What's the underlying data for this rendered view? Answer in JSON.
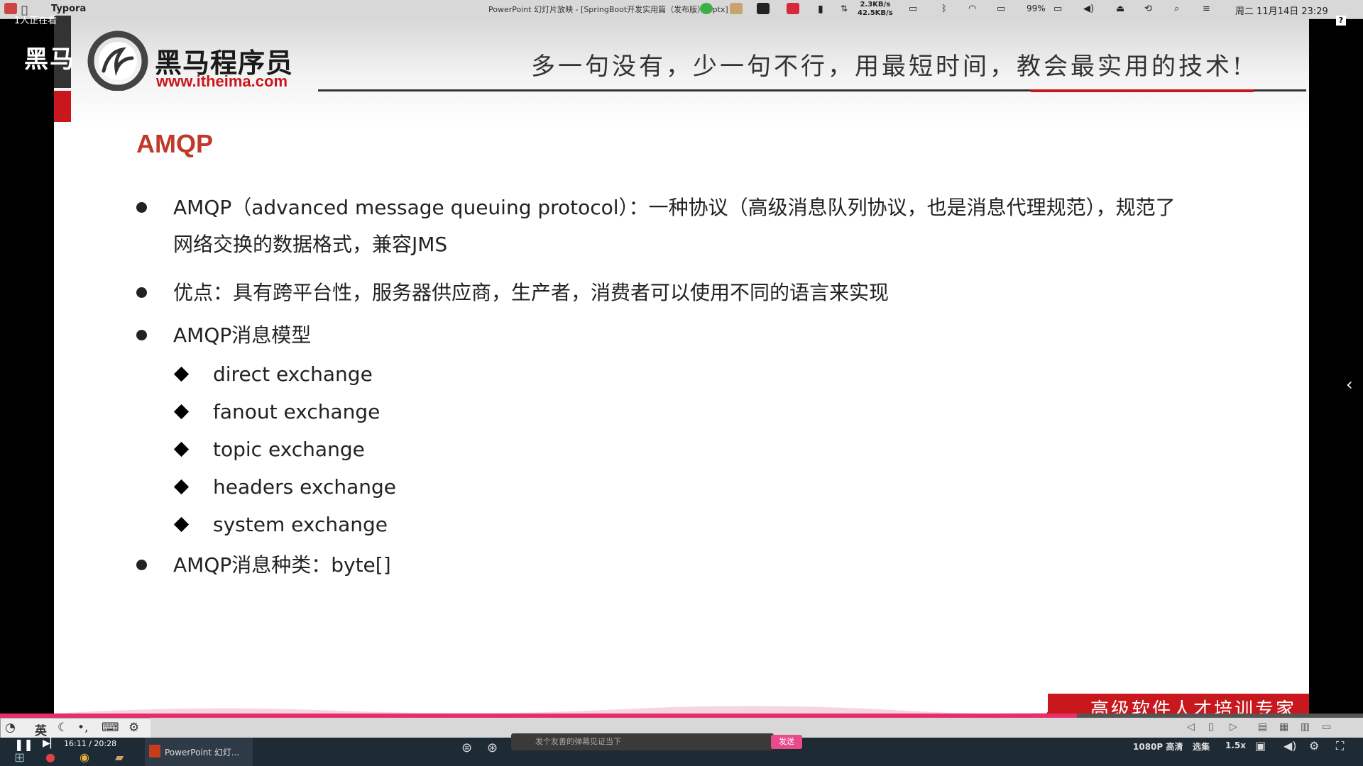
{
  "menubar": {
    "app_name": "Typora",
    "window_title": "PowerPoint 幻灯片放映 - [SpringBoot开发实用篇（发布版）.pptx]",
    "net_up": "2.3KB/s",
    "net_down": "42.5KB/s",
    "battery": "99%",
    "datetime": "周二 11月14日 23:29"
  },
  "overlay": {
    "viewer_count": "1人正在看",
    "watermark": "黑马"
  },
  "slide": {
    "brand_cn": "黑马程序员",
    "brand_url": "www.itheima.com",
    "slogan": "多一句没有，少一句不行，用最短时间，教会最实用的技术!",
    "title": "AMQP",
    "bullets": [
      {
        "line1": "AMQP（advanced message queuing protocol）：一种协议（高级消息队列协议，也是消息代理规范），规范了",
        "line2": "网络交换的数据格式，兼容JMS"
      },
      {
        "line1": "优点：具有跨平台性，服务器供应商，生产者，消费者可以使用不同的语言来实现"
      },
      {
        "line1": "AMQP消息模型"
      },
      {
        "line1": "AMQP消息种类：byte[]"
      }
    ],
    "exchange_types": [
      "direct exchange",
      "fanout exchange",
      "topic exchange",
      "headers exchange",
      "system exchange"
    ],
    "footer_tagline": "高级软件人才培训专家"
  },
  "ime": {
    "lang": "英"
  },
  "player": {
    "time": "16:11 / 20:28",
    "progress": 0.79,
    "danmu_placeholder": "发个友善的弹幕见证当下",
    "send_label": "发送",
    "quality": "1080P 高清",
    "episodes": "选集",
    "speed": "1.5x"
  },
  "taskbar": {
    "ppt_task_label": "PowerPoint 幻灯..."
  },
  "colors": {
    "brand_red": "#c8181e",
    "title_red": "#c0392b",
    "progress_pink": "#e62e6b"
  }
}
